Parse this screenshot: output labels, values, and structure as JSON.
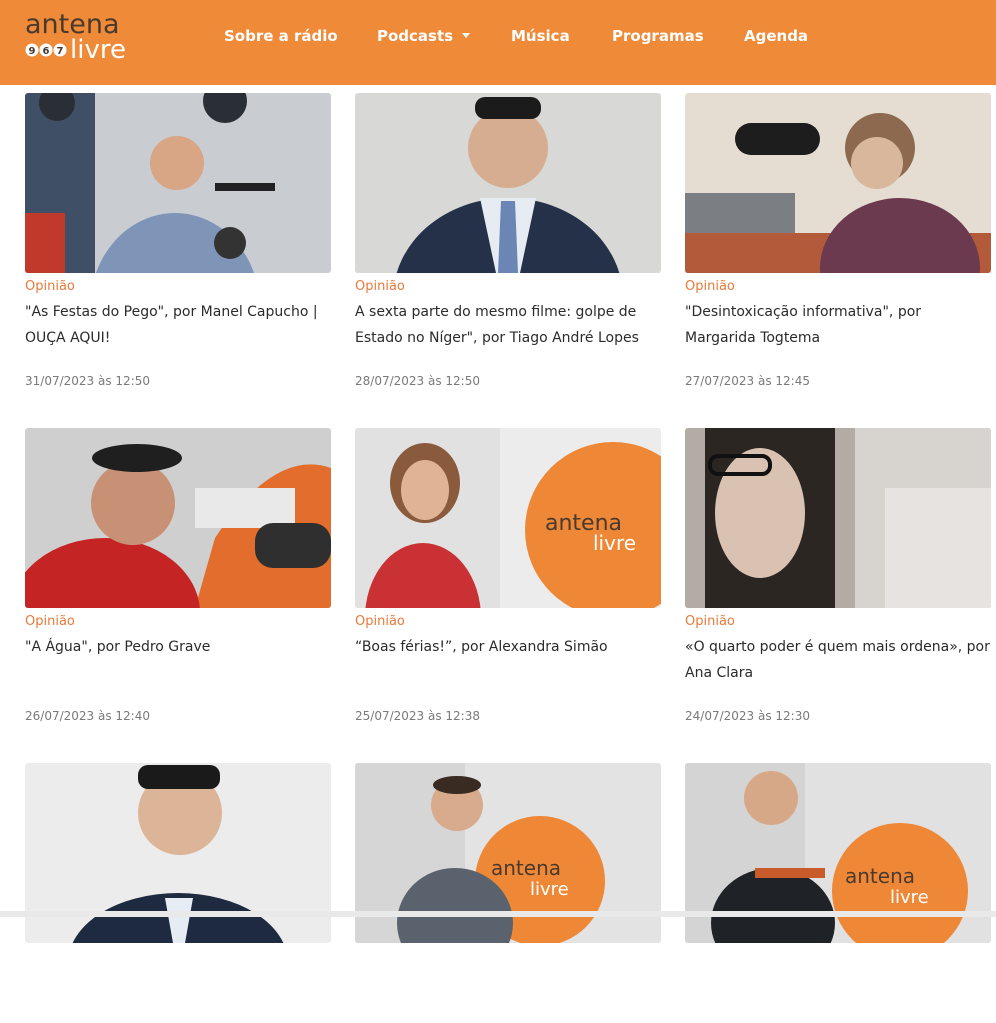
{
  "brand": {
    "logo_top": "antena",
    "logo_bottom": "livre",
    "logo_freq": [
      "9",
      "6",
      "7"
    ],
    "accent_color": "#ef8a39"
  },
  "nav": {
    "items": [
      {
        "label": "Sobre a rádio"
      },
      {
        "label": "Podcasts",
        "dropdown": true
      },
      {
        "label": "Música"
      },
      {
        "label": "Programas"
      },
      {
        "label": "Agenda"
      }
    ]
  },
  "articles": [
    {
      "category": "Opinião",
      "title": "\"As Festas do Pego\", por Manel Capucho | OUÇA AQUI!",
      "date": "31/07/2023 às 12:50"
    },
    {
      "category": "Opinião",
      "title": "A sexta parte do mesmo filme: golpe de Estado no Níger\", por Tiago André Lopes",
      "date": "28/07/2023 às 12:50"
    },
    {
      "category": "Opinião",
      "title": "\"Desintoxicação informativa\", por Margarida Togtema",
      "date": "27/07/2023 às 12:45"
    },
    {
      "category": "Opinião",
      "title": "\"A Água\", por Pedro Grave",
      "date": "26/07/2023 às 12:40"
    },
    {
      "category": "Opinião",
      "title": "“Boas férias!”, por Alexandra Simão",
      "date": "25/07/2023 às 12:38"
    },
    {
      "category": "Opinião",
      "title": "«O quarto poder é quem mais ordena», por Ana Clara",
      "date": "24/07/2023 às 12:30"
    },
    {
      "category": "",
      "title": "",
      "date": ""
    },
    {
      "category": "",
      "title": "",
      "date": ""
    },
    {
      "category": "",
      "title": "",
      "date": ""
    }
  ]
}
